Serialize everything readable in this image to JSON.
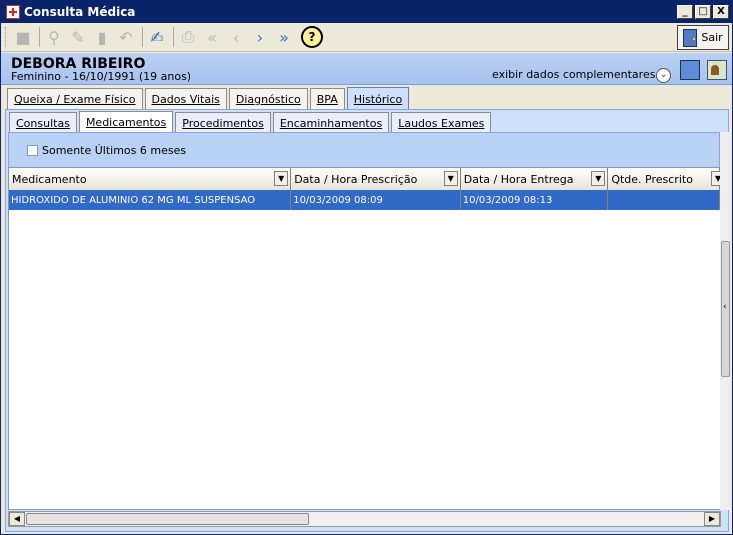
{
  "window": {
    "title": "Consulta Médica",
    "minimize": "_",
    "maximize": "□",
    "close": "X"
  },
  "toolbar": {
    "icons": [
      "new-icon",
      "binoculars-icon",
      "eraser-icon",
      "trash-icon",
      "undo-icon",
      "edit-icon",
      "print-icon",
      "first-icon",
      "prev-icon",
      "next-icon",
      "last-icon",
      "help-icon"
    ],
    "help_label": "?",
    "sair_label": "Sair"
  },
  "patient": {
    "name": "DEBORA RIBEIRO",
    "info": "Feminino - 16/10/1991 (19 anos)",
    "exibir": "exibir dados complementares..."
  },
  "main_tabs": [
    {
      "label": "Queixa / Exame Físico"
    },
    {
      "label": "Dados Vitais"
    },
    {
      "label": "Diagnóstico"
    },
    {
      "label": "BPA"
    },
    {
      "label": "Histórico"
    }
  ],
  "sub_tabs": [
    {
      "label": "Consultas"
    },
    {
      "label": "Medicamentos"
    },
    {
      "label": "Procedimentos"
    },
    {
      "label": "Encaminhamentos"
    },
    {
      "label": "Laudos Exames"
    }
  ],
  "filter": {
    "checkbox_label": "Somente Últimos 6 meses",
    "checked": false
  },
  "grid": {
    "columns": [
      "Medicamento",
      "Data / Hora Prescrição",
      "Data / Hora Entrega",
      "Qtde. Prescrito"
    ],
    "rows": [
      [
        "HIDROXIDO DE ALUMINIO 62 MG ML SUSPENSAO",
        "10/03/2009 08:09",
        "10/03/2009 08:13",
        ""
      ]
    ]
  },
  "colors": {
    "selection": "#3169c6",
    "panel": "#cfe0fb",
    "title": "#0a246a"
  }
}
